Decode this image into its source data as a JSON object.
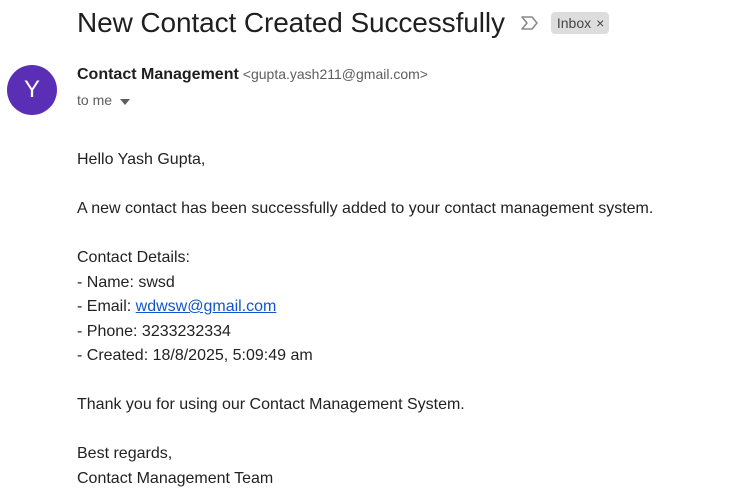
{
  "email": {
    "subject": "New Contact Created Successfully",
    "label_chip": "Inbox",
    "label_remove": "×",
    "sender": {
      "initial": "Y",
      "name": "Contact Management",
      "address": "<gupta.yash211@gmail.com>"
    },
    "recipient": "to me",
    "body": {
      "greeting": "Hello Yash Gupta,",
      "intro": "A new contact has been successfully added to your contact management system.",
      "details_heading": "Contact Details:",
      "name_line": "- Name: swsd",
      "email_prefix": "- Email: ",
      "email_link": "wdwsw@gmail.com",
      "phone_line": "- Phone: 3233232334",
      "created_line": "- Created: 18/8/2025, 5:09:49 am",
      "thanks": "Thank you for using our Contact Management System.",
      "closing": "Best regards,",
      "signature": "Contact Management Team"
    }
  },
  "icons": {
    "importance": "importance-marker-icon",
    "dropdown": "chevron-down-icon"
  },
  "colors": {
    "avatar_bg": "#5b2fb5",
    "link": "#1155cc",
    "chip_bg": "#dddddd"
  }
}
